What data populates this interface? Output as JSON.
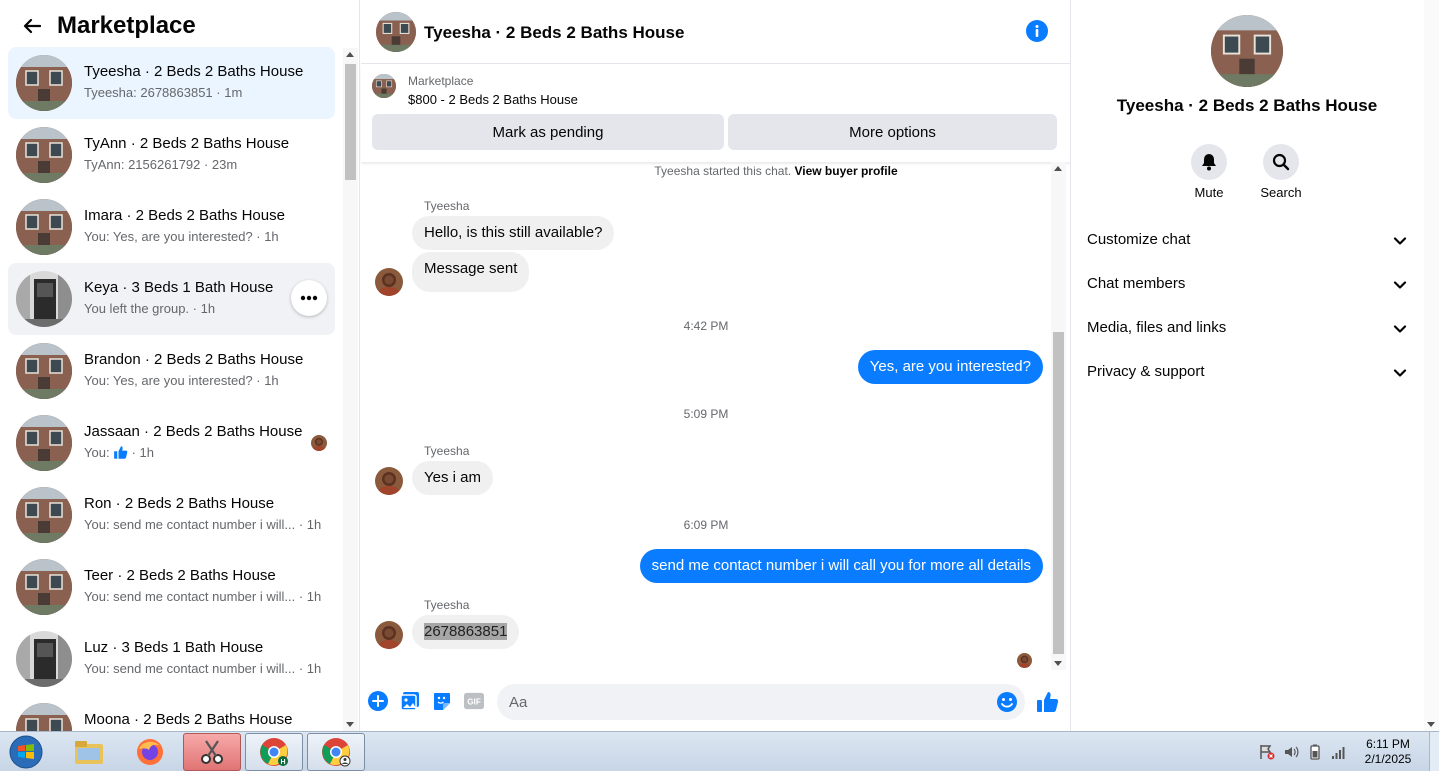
{
  "left": {
    "title": "Marketplace",
    "conversations": [
      {
        "title": "Tyeesha · 2 Beds 2 Baths House",
        "sub": "Tyeesha: 2678863851 · 1m",
        "active": true,
        "avatar": "house"
      },
      {
        "title": "TyAnn · 2 Beds 2 Baths House",
        "sub": "TyAnn: 2156261792 · 23m",
        "avatar": "house"
      },
      {
        "title": "Imara · 2 Beds 2 Baths House",
        "sub": "You: Yes, are you interested? · 1h",
        "avatar": "house"
      },
      {
        "title": "Keya · 3 Beds 1 Bath House",
        "sub": "You left the group. · 1h",
        "hover": true,
        "avatar": "door"
      },
      {
        "title": "Brandon · 2 Beds 2 Baths House",
        "sub": "You: Yes, are you interested? · 1h",
        "avatar": "house"
      },
      {
        "title": "Jassaan · 2 Beds 2 Baths House",
        "sub_prefix": "You:",
        "sub_suffix": "· 1h",
        "avatar": "house"
      },
      {
        "title": "Ron · 2 Beds 2 Baths House",
        "sub": "You: send me contact number i will... · 1h",
        "avatar": "house"
      },
      {
        "title": "Teer · 2 Beds 2 Baths House",
        "sub": "You: send me contact number i will... · 1h",
        "avatar": "house"
      },
      {
        "title": "Luz · 3 Beds 1 Bath House",
        "sub": "You: send me contact number i will... · 1h",
        "avatar": "door"
      },
      {
        "title": "Moona · 2 Beds 2 Baths House",
        "sub": "",
        "avatar": "house"
      }
    ]
  },
  "chat": {
    "header_title": "Tyeesha · 2 Beds 2 Baths House",
    "listing_label": "Marketplace",
    "listing_price": "$800 - 2 Beds 2 Baths House",
    "mark_pending": "Mark as pending",
    "more_options": "More options",
    "started_text": "Tyeesha started this chat.",
    "buyer_profile_link": "View buyer profile",
    "sender_name": "Tyeesha",
    "msg1": "Hello, is this still available?",
    "msg2": "Message sent",
    "time1": "4:42 PM",
    "reply1": "Yes, are you interested?",
    "time2": "5:09 PM",
    "msg3": "Yes i am",
    "time3": "6:09 PM",
    "reply2": "send me contact number i will call you for more all details",
    "msg4": "2678863851",
    "input_placeholder": "Aa"
  },
  "right": {
    "title": "Tyeesha · 2 Beds 2 Baths House",
    "mute_label": "Mute",
    "search_label": "Search",
    "sections": [
      "Customize chat",
      "Chat members",
      "Media, files and links",
      "Privacy & support"
    ]
  },
  "taskbar": {
    "time": "6:11 PM",
    "date": "2/1/2025"
  },
  "colors": {
    "accent": "#0a7cff",
    "active_row": "#ebf5ff",
    "bubble_in": "#f0f0f0"
  }
}
